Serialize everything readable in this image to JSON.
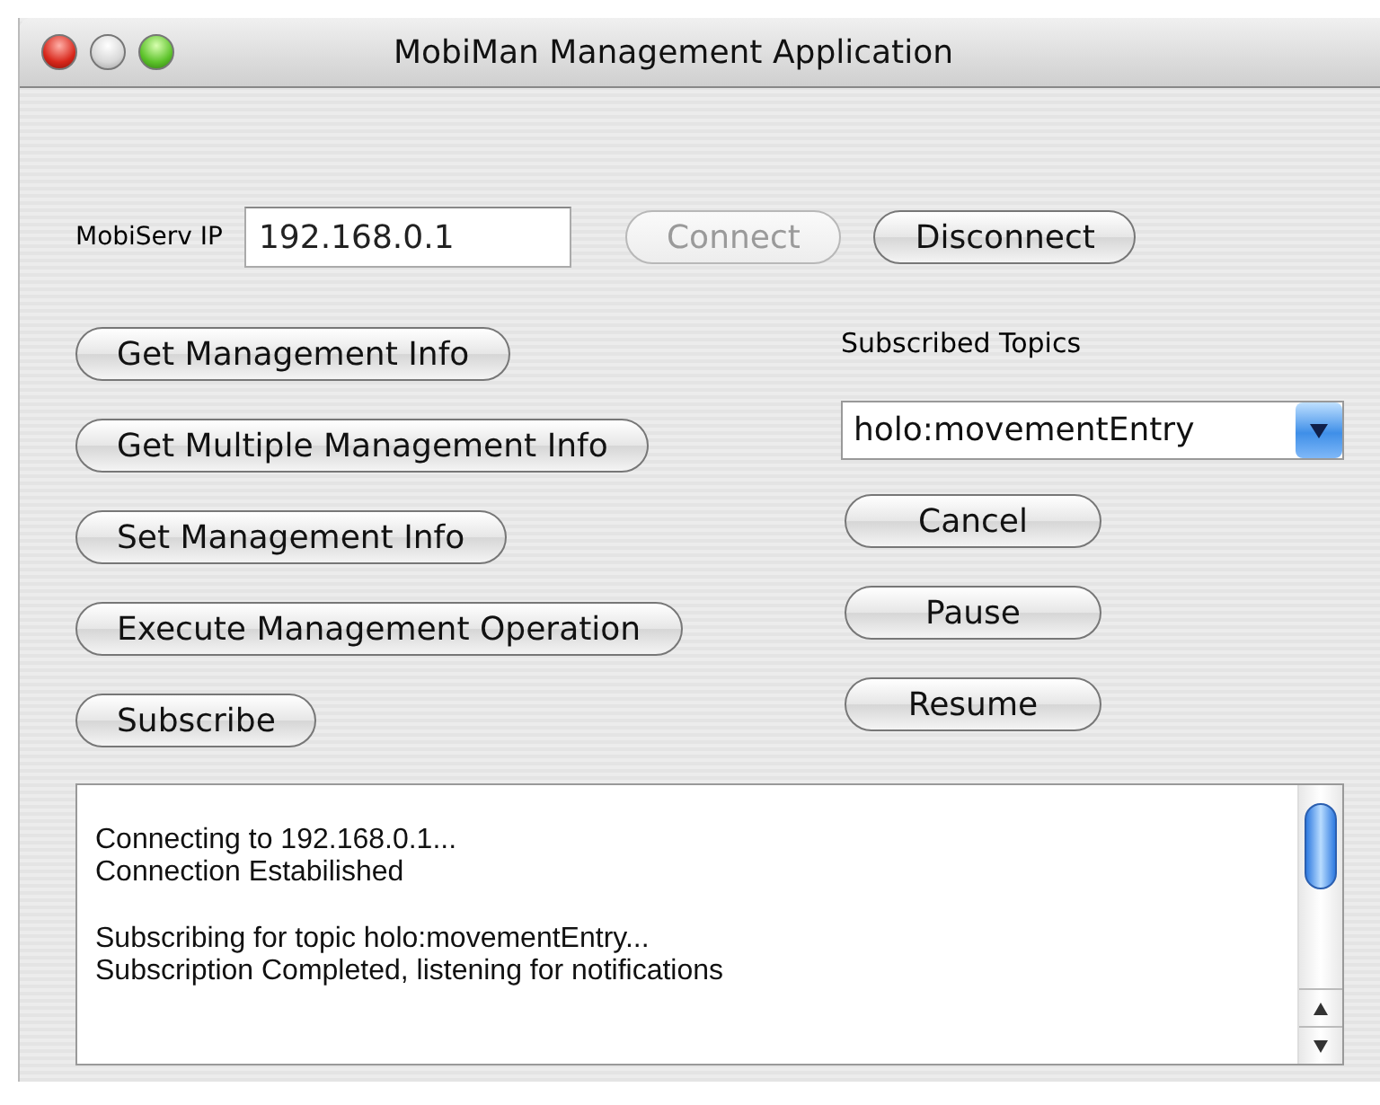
{
  "window": {
    "title": "MobiMan Management Application"
  },
  "connection": {
    "label": "MobiServ IP",
    "ip": "192.168.0.1",
    "buttons": [
      {
        "label": "Connect",
        "disabled": true
      },
      {
        "label": "Disconnect",
        "disabled": false
      }
    ]
  },
  "actions": [
    {
      "label": "Get Management Info"
    },
    {
      "label": "Get Multiple Management Info"
    },
    {
      "label": "Set Management Info"
    },
    {
      "label": "Execute Management Operation"
    },
    {
      "label": "Subscribe"
    }
  ],
  "topics": {
    "label": "Subscribed Topics",
    "selected_topic": "holo:movementEntry",
    "buttons": [
      {
        "label": "Cancel"
      },
      {
        "label": "Pause"
      },
      {
        "label": "Resume"
      }
    ]
  },
  "log": [
    {
      "lines": [
        "Connecting to 192.168.0.1...",
        "Connection Estabilished"
      ]
    },
    {
      "lines": [
        "Subscribing for topic holo:movementEntry...",
        "Subscription Completed, listening for notifications"
      ]
    }
  ]
}
